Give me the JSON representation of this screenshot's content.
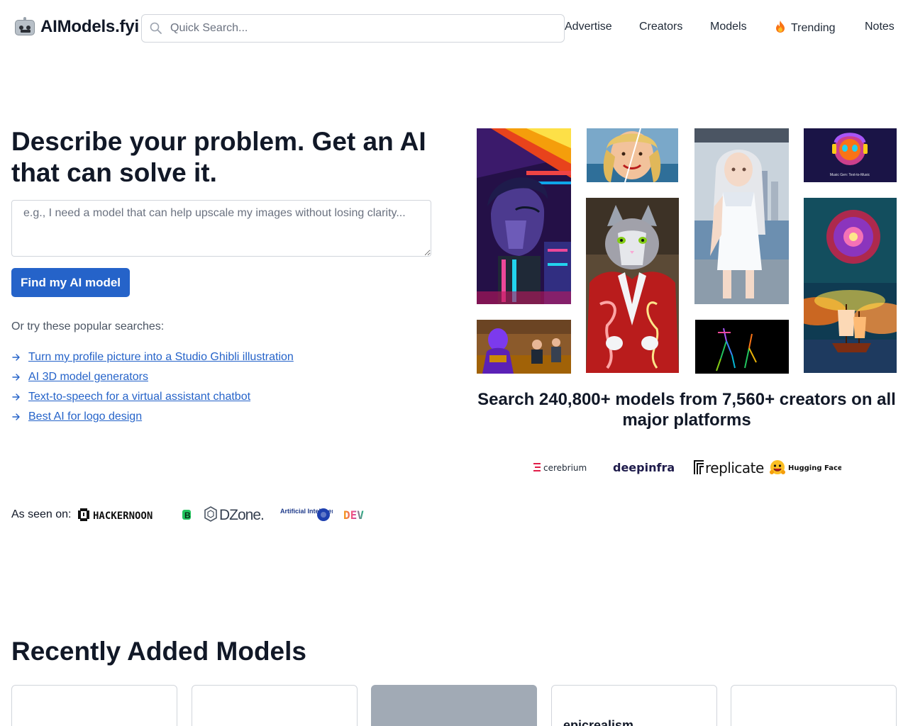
{
  "header": {
    "logo_text": "AIModels.fyi",
    "search_placeholder": "Quick Search...",
    "nav": [
      {
        "label": "Advertise",
        "icon": null
      },
      {
        "label": "Creators",
        "icon": null
      },
      {
        "label": "Models",
        "icon": null
      },
      {
        "label": "Trending",
        "icon": "fire-icon"
      },
      {
        "label": "Notes",
        "icon": null
      }
    ]
  },
  "hero": {
    "title": "Describe your problem. Get an AI that can solve it.",
    "input_placeholder": "e.g., I need a model that can help upscale my images without losing clarity...",
    "cta_label": "Find my AI model",
    "popular_label": "Or try these popular searches:",
    "popular_searches": [
      "Turn my profile picture into a Studio Ghibli illustration",
      "AI 3D model generators",
      "Text-to-speech for a virtual assistant chatbot",
      "Best AI for logo design"
    ]
  },
  "as_seen_on": {
    "label": "As seen on:",
    "logos": [
      "HACKERNOON",
      "B",
      "DZone.",
      "Artificial Intelligence",
      "DEV"
    ]
  },
  "gallery": {
    "caption": "Search 240,800+ models from 7,560+ creators on all major platforms",
    "tile_small_text": "Music Gen: Text-to-Music",
    "platforms": [
      "cerebrium",
      "deepinfra",
      "replicate",
      "Hugging Face"
    ]
  },
  "recent": {
    "title": "Recently Added Models",
    "cards": [
      {
        "name": ""
      },
      {
        "name": ""
      },
      {
        "name": ""
      },
      {
        "name": "epicrealism"
      },
      {
        "name": ""
      }
    ]
  },
  "colors": {
    "accent": "#2563c9",
    "text": "#111827",
    "border": "#d1d5db"
  }
}
